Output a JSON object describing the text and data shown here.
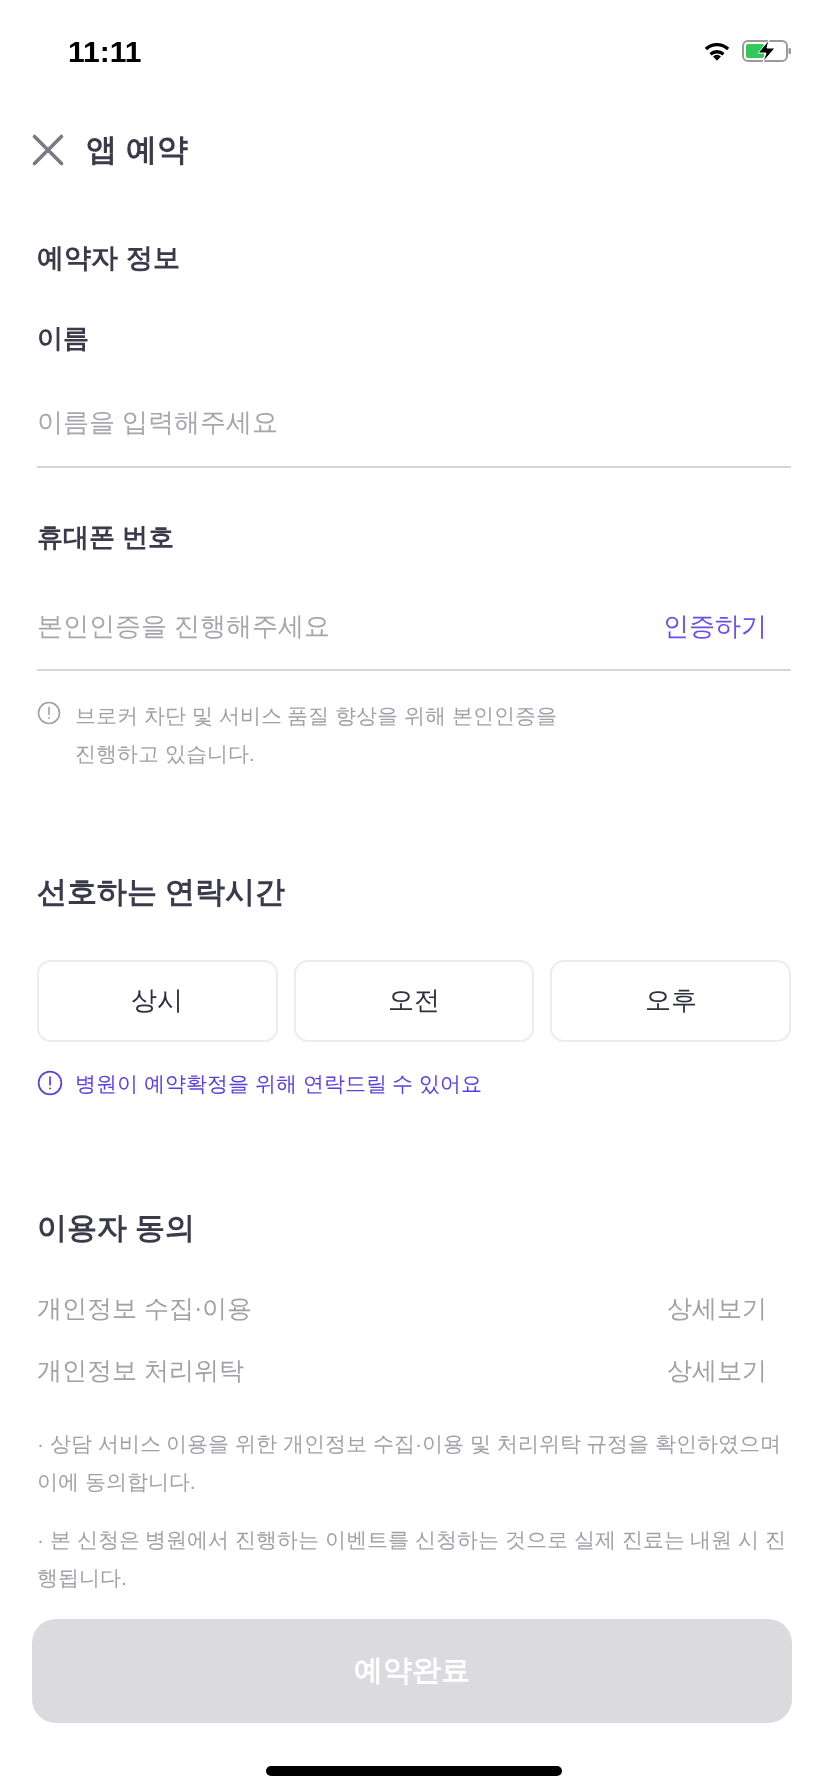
{
  "status_bar": {
    "time": "11:11"
  },
  "header": {
    "title": "앱 예약"
  },
  "booker": {
    "title": "예약자 정보",
    "name": {
      "label": "이름",
      "placeholder": "이름을 입력해주세요"
    },
    "phone": {
      "label": "휴대폰 번호",
      "placeholder": "본인인증을 진행해주세요",
      "action": "인증하기"
    },
    "notice": "브로커 차단 및 서비스 품질 향상을 위해 본인인증을 진행하고 있습니다."
  },
  "contact_time": {
    "title": "선호하는 연락시간",
    "options": [
      {
        "label": "상시",
        "selected": false
      },
      {
        "label": "오전",
        "selected": false
      },
      {
        "label": "오후",
        "selected": false
      }
    ],
    "notice": "병원이 예약확정을 위해 연락드릴 수 있어요"
  },
  "consent": {
    "title": "이용자 동의",
    "items": [
      {
        "label": "개인정보 수집·이용",
        "action": "상세보기"
      },
      {
        "label": "개인정보 처리위탁",
        "action": "상세보기"
      }
    ],
    "notes": [
      "· 상담 서비스 이용을 위한 개인정보 수집·이용 및 처리위탁 규정을 확인하였으며 이에 동의합니다.",
      "· 본 신청은 병원에서 진행하는 이벤트를 신청하는 것으로 실제 진료는 내원 시 진행됩니다."
    ]
  },
  "submit": {
    "label": "예약완료",
    "disabled": true
  }
}
